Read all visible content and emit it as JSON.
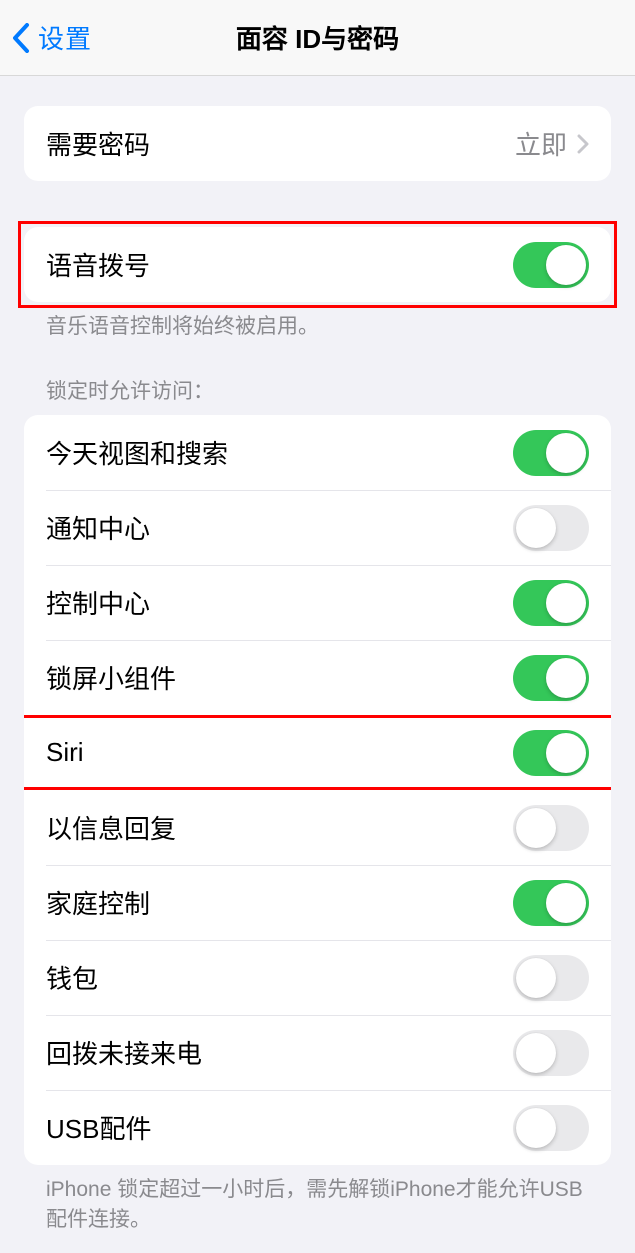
{
  "header": {
    "back_label": "设置",
    "title": "面容 ID与密码"
  },
  "group1": {
    "require_passcode_label": "需要密码",
    "require_passcode_value": "立即"
  },
  "group2": {
    "voice_dial_label": "语音拨号",
    "voice_dial_on": true,
    "footer": "音乐语音控制将始终被启用。"
  },
  "lock_section": {
    "header": "锁定时允许访问：",
    "items": [
      {
        "label": "今天视图和搜索",
        "on": true
      },
      {
        "label": "通知中心",
        "on": false
      },
      {
        "label": "控制中心",
        "on": true
      },
      {
        "label": "锁屏小组件",
        "on": true
      },
      {
        "label": "Siri",
        "on": true
      },
      {
        "label": "以信息回复",
        "on": false
      },
      {
        "label": "家庭控制",
        "on": true
      },
      {
        "label": "钱包",
        "on": false
      },
      {
        "label": "回拨未接来电",
        "on": false
      },
      {
        "label": "USB配件",
        "on": false
      }
    ],
    "footer": "iPhone 锁定超过一小时后，需先解锁iPhone才能允许USB 配件连接。"
  }
}
